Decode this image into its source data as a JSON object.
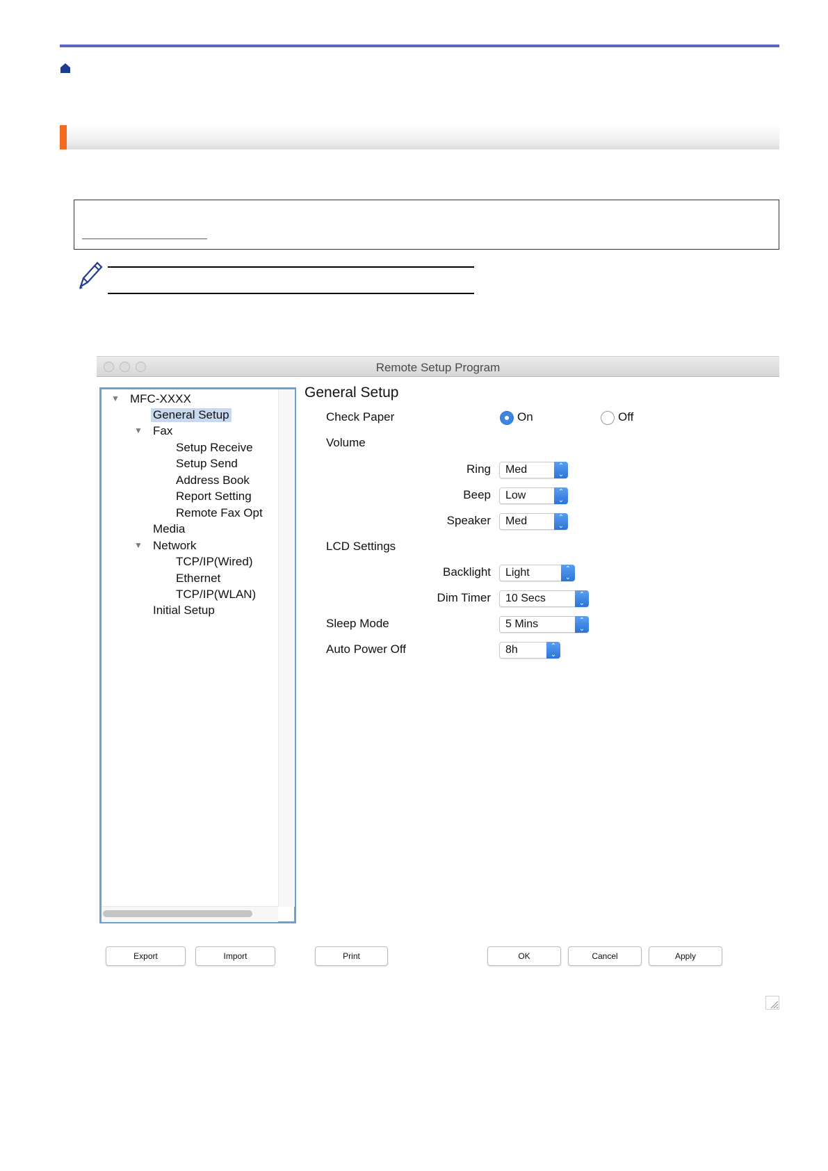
{
  "window": {
    "title": "Remote Setup Program"
  },
  "tree": {
    "items": [
      {
        "label": "MFC-XXXX",
        "level": 0,
        "expanded": true
      },
      {
        "label": "General Setup",
        "level": 1,
        "selected": true
      },
      {
        "label": "Fax",
        "level": 1,
        "expanded": true
      },
      {
        "label": "Setup Receive",
        "level": 2
      },
      {
        "label": "Setup Send",
        "level": 2
      },
      {
        "label": "Address Book",
        "level": 2
      },
      {
        "label": "Report Setting",
        "level": 2
      },
      {
        "label": "Remote Fax Opt",
        "level": 2
      },
      {
        "label": "Media",
        "level": 1
      },
      {
        "label": "Network",
        "level": 1,
        "expanded": true
      },
      {
        "label": "TCP/IP(Wired)",
        "level": 2
      },
      {
        "label": "Ethernet",
        "level": 2
      },
      {
        "label": "TCP/IP(WLAN)",
        "level": 2
      },
      {
        "label": "Initial Setup",
        "level": 1
      }
    ]
  },
  "settings": {
    "title": "General Setup",
    "check_paper": {
      "label": "Check Paper",
      "on_label": "On",
      "off_label": "Off",
      "selected": "On"
    },
    "volume": {
      "label": "Volume",
      "ring": {
        "label": "Ring",
        "value": "Med"
      },
      "beep": {
        "label": "Beep",
        "value": "Low"
      },
      "speaker": {
        "label": "Speaker",
        "value": "Med"
      }
    },
    "lcd": {
      "label": "LCD Settings",
      "backlight": {
        "label": "Backlight",
        "value": "Light"
      },
      "dim_timer": {
        "label": "Dim Timer",
        "value": "10 Secs"
      }
    },
    "sleep_mode": {
      "label": "Sleep Mode",
      "value": "5 Mins"
    },
    "auto_power_off": {
      "label": "Auto Power Off",
      "value": "8h"
    }
  },
  "buttons": {
    "export": "Export",
    "import": "Import",
    "print": "Print",
    "ok": "OK",
    "cancel": "Cancel",
    "apply": "Apply"
  },
  "colors": {
    "accent_rule": "#5b66c8",
    "section_accent": "#f26b21",
    "select_blue": "#2b74d9",
    "tree_border": "#6e9fd6"
  }
}
